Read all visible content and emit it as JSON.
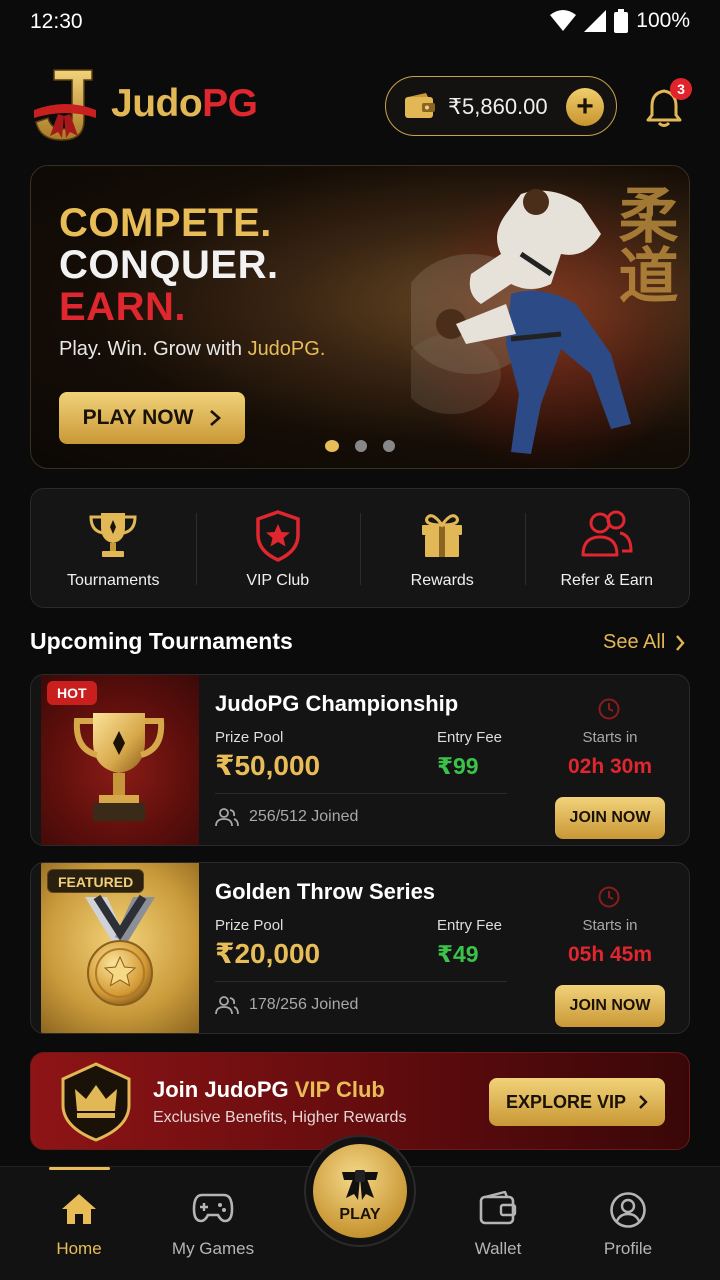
{
  "status_bar": {
    "time": "12:30",
    "battery": "100%"
  },
  "header": {
    "brand_part1": "Judo",
    "brand_part2": "PG",
    "wallet_balance": "₹5,860.00",
    "add_funds": "+",
    "notification_count": "3"
  },
  "hero": {
    "line1": "COMPETE.",
    "line2": "CONQUER.",
    "line3": "EARN.",
    "tagline_prefix": "Play. Win. Grow with ",
    "tagline_brand": "JudoPG.",
    "cta": "PLAY NOW",
    "slides_total": 3,
    "active_slide": 1
  },
  "quick_menu": [
    {
      "label": "Tournaments",
      "icon": "trophy-icon"
    },
    {
      "label": "VIP Club",
      "icon": "shield-star-icon"
    },
    {
      "label": "Rewards",
      "icon": "gift-icon"
    },
    {
      "label": "Refer & Earn",
      "icon": "users-icon"
    }
  ],
  "upcoming": {
    "title": "Upcoming Tournaments",
    "see_all": "See All",
    "tournaments": [
      {
        "tag": "HOT",
        "name": "JudoPG Championship",
        "prize_label": "Prize Pool",
        "prize": "₹50,000",
        "fee_label": "Entry Fee",
        "fee": "₹99",
        "joined": "256/512 Joined",
        "starts_label": "Starts in",
        "starts_in": "02h 30m",
        "cta": "JOIN NOW"
      },
      {
        "tag": "FEATURED",
        "name": "Golden Throw Series",
        "prize_label": "Prize Pool",
        "prize": "₹20,000",
        "fee_label": "Entry Fee",
        "fee": "₹49",
        "joined": "178/256 Joined",
        "starts_label": "Starts in",
        "starts_in": "05h 45m",
        "cta": "JOIN NOW"
      }
    ]
  },
  "vip_banner": {
    "title_prefix": "Join JudoPG ",
    "title_highlight": "VIP Club",
    "subtitle": "Exclusive Benefits, Higher Rewards",
    "cta": "EXPLORE VIP"
  },
  "bottom_nav": {
    "home": "Home",
    "my_games": "My Games",
    "play": "PLAY",
    "wallet": "Wallet",
    "profile": "Profile",
    "active": "Home"
  },
  "colors": {
    "gold": "#e8bd58",
    "red": "#e0262e",
    "green": "#3cc24a",
    "background": "#0b0b0b"
  }
}
